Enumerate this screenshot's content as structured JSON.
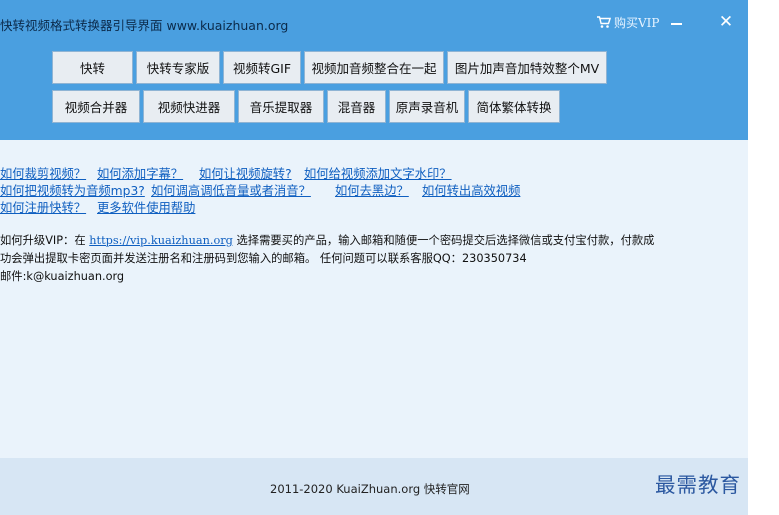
{
  "window": {
    "title": "快转视频格式转换器引导界面 www.kuaizhuan.org",
    "buy_vip": "购买VIP",
    "minimize_glyph": "—",
    "close_glyph": "✕",
    "accent_color": "#4a9fe0"
  },
  "toolbar": {
    "row1": [
      "快转",
      "快转专家版",
      "视频转GIF",
      "视频加音频整合在一起",
      "图片加声音加特效整个MV"
    ],
    "row2": [
      "视频合并器",
      "视频快进器",
      "音乐提取器",
      "混音器",
      "原声录音机",
      "简体繁体转换"
    ]
  },
  "help_links": {
    "crop": "如何裁剪视频？",
    "subtitle": "如何添加字幕？",
    "rotate": "如何让视频旋转?",
    "watermark": "如何给视频添加文字水印？",
    "to_mp3": "如何把视频转为音频mp3?",
    "volume": "如何调高调低音量或者消音？",
    "black_border": "如何去黑边？",
    "efficient": "如何转出高效视频",
    "register": "如何注册快转？",
    "more_help": "更多软件使用帮助"
  },
  "vip_info": {
    "prefix": "如何升级VIP：在",
    "url": "https://vip.kuaizhuan.org",
    "suffix1": "选择需要买的产品，输入邮箱和随便一个密码提交后选择微信或支付宝付款，付款成",
    "line2": "功会弹出提取卡密页面并发送注册名和注册码到您输入的邮箱。 任何问题可以联系客服QQ：230350734",
    "email": "邮件:k@kuaizhuan.org"
  },
  "footer": {
    "text": "2011-2020 KuaiZhuan.org 快转官网"
  },
  "watermark": "最需教育"
}
